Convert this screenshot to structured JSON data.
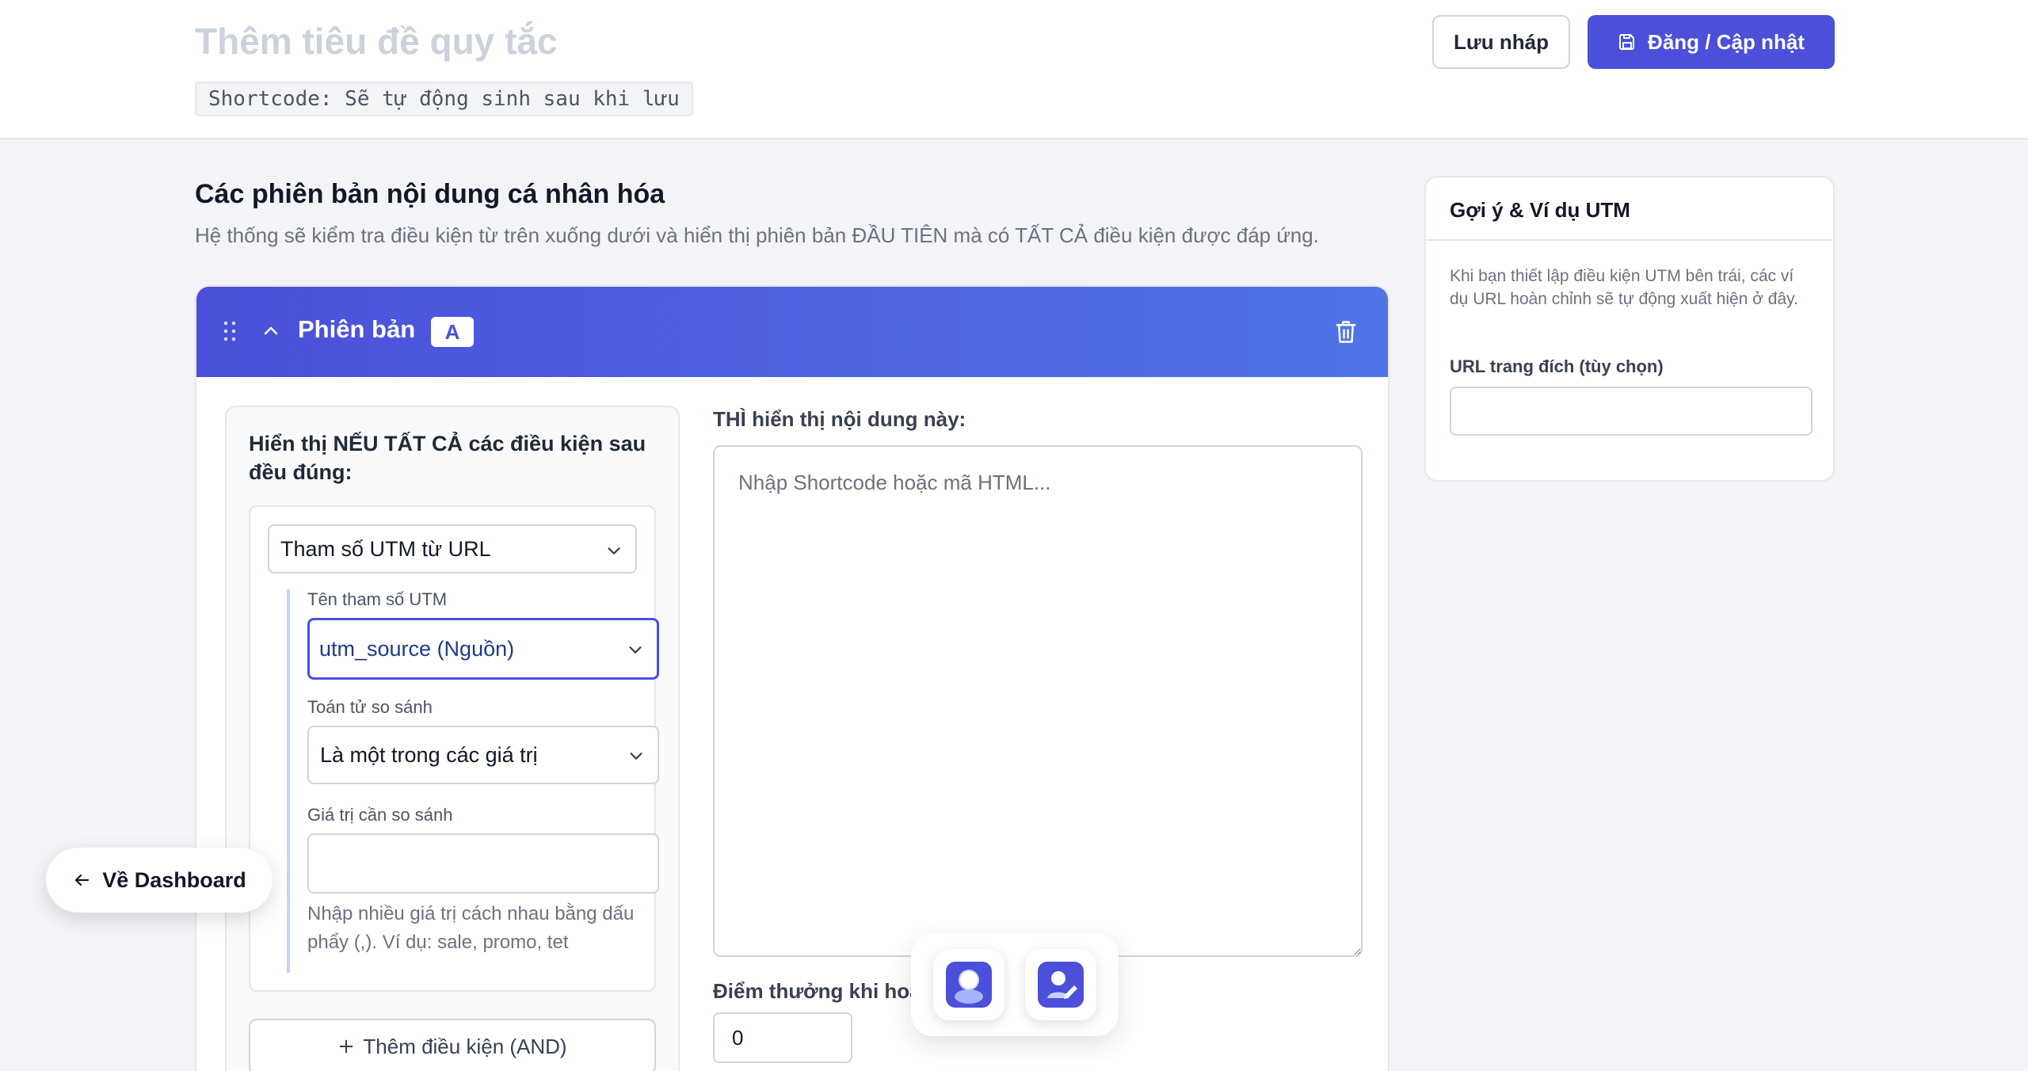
{
  "header": {
    "title_placeholder": "Thêm tiêu đề quy tắc",
    "shortcode": "Shortcode: Sẽ tự động sinh sau khi lưu",
    "save_draft_label": "Lưu nháp",
    "publish_label": "Đăng / Cập nhật"
  },
  "section": {
    "title": "Các phiên bản nội dung cá nhân hóa",
    "description": "Hệ thống sẽ kiểm tra điều kiện từ trên xuống dưới và hiển thị phiên bản ĐẦU TIÊN mà có TẤT CẢ điều kiện được đáp ứng."
  },
  "version": {
    "label": "Phiên bản",
    "badge": "A",
    "conditions": {
      "title": "Hiển thị NẾU TẤT CẢ các điều kiện sau đều đúng:",
      "type_value": "Tham số UTM từ URL",
      "param_label": "Tên tham số UTM",
      "param_value": "utm_source (Nguồn)",
      "operator_label": "Toán tử so sánh",
      "operator_value": "Là một trong các giá trị",
      "compare_label": "Giá trị cần so sánh",
      "compare_value": "",
      "compare_hint": "Nhập nhiều giá trị cách nhau bằng dấu phẩy (,). Ví dụ: sale, promo, tet",
      "add_condition_label": "Thêm điều kiện (AND)"
    },
    "content": {
      "label": "THÌ hiển thị nội dung này:",
      "placeholder": "Nhập Shortcode hoặc mã HTML..."
    },
    "reward": {
      "label": "Điểm thưởng khi hoà",
      "value": "0"
    }
  },
  "sidebar": {
    "title": "Gợi ý & Ví dụ UTM",
    "description": "Khi bạn thiết lập điều kiện UTM bên trái, các ví dụ URL hoàn chỉnh sẽ tự động xuất hiện ở đây.",
    "landing_label": "URL trang đích (tùy chọn)",
    "landing_value": ""
  },
  "back_button": {
    "label": "Về Dashboard"
  },
  "colors": {
    "primary": "#4b4fd9",
    "header_gradient_end": "#4f75e6",
    "background": "#f3f4f8",
    "focus_border": "#4b4fd9",
    "sub_group_line": "#c7d2fe"
  },
  "icons": {
    "publish": "save-icon",
    "back": "arrow-left-icon",
    "drag": "drag-handle-icon",
    "collapse": "chevron-up-icon",
    "delete": "trash-icon",
    "select": "chevron-down-icon",
    "add": "plus-icon",
    "floating_1": "user-chat-icon",
    "floating_2": "user-edit-icon"
  }
}
